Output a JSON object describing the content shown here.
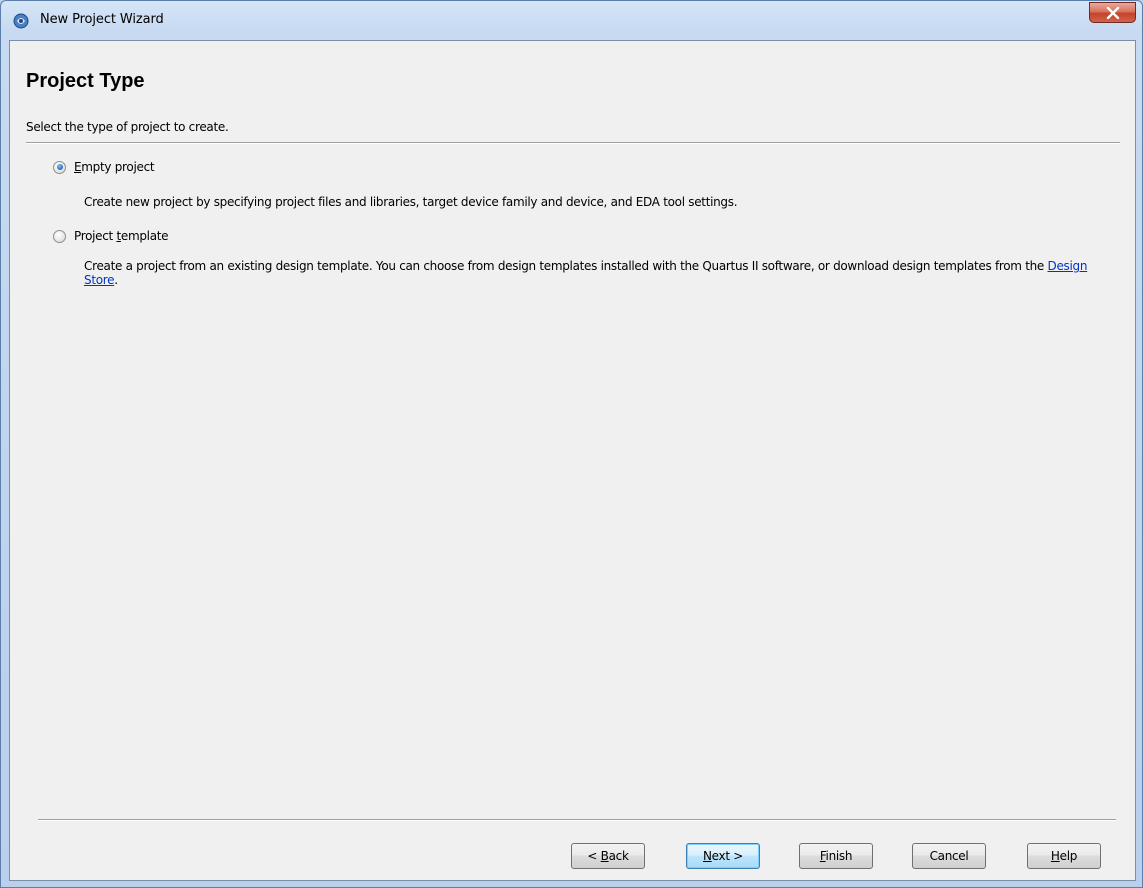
{
  "window": {
    "title": "New Project Wizard",
    "close_symbol": "✕"
  },
  "header": {
    "title": "Project Type",
    "subtitle": "Select the type of project to create."
  },
  "options": [
    {
      "label": "Empty project",
      "mnemonic_index": 0,
      "checked": true,
      "description": "Create new project by specifying project files and libraries, target device family and device, and EDA tool settings."
    },
    {
      "label": "Project template",
      "mnemonic_index": 8,
      "checked": false,
      "description_before_link": "Create a project from an existing design template. You can choose from design templates installed with the Quartus II software, or download design templates from the ",
      "link_text": "Design Store",
      "description_after_link": "."
    }
  ],
  "buttons": {
    "back": {
      "pre": "< ",
      "mnemonic": "B",
      "post": "ack"
    },
    "next": {
      "pre": "",
      "mnemonic": "N",
      "post": "ext >"
    },
    "finish": {
      "pre": "",
      "mnemonic": "F",
      "post": "inish"
    },
    "cancel": {
      "label": "Cancel"
    },
    "help": {
      "pre": "",
      "mnemonic": "H",
      "post": "elp"
    }
  },
  "colors": {
    "link": "#0033cc",
    "radio_selected": "#2f78c4",
    "close_button": "#c4432a"
  }
}
